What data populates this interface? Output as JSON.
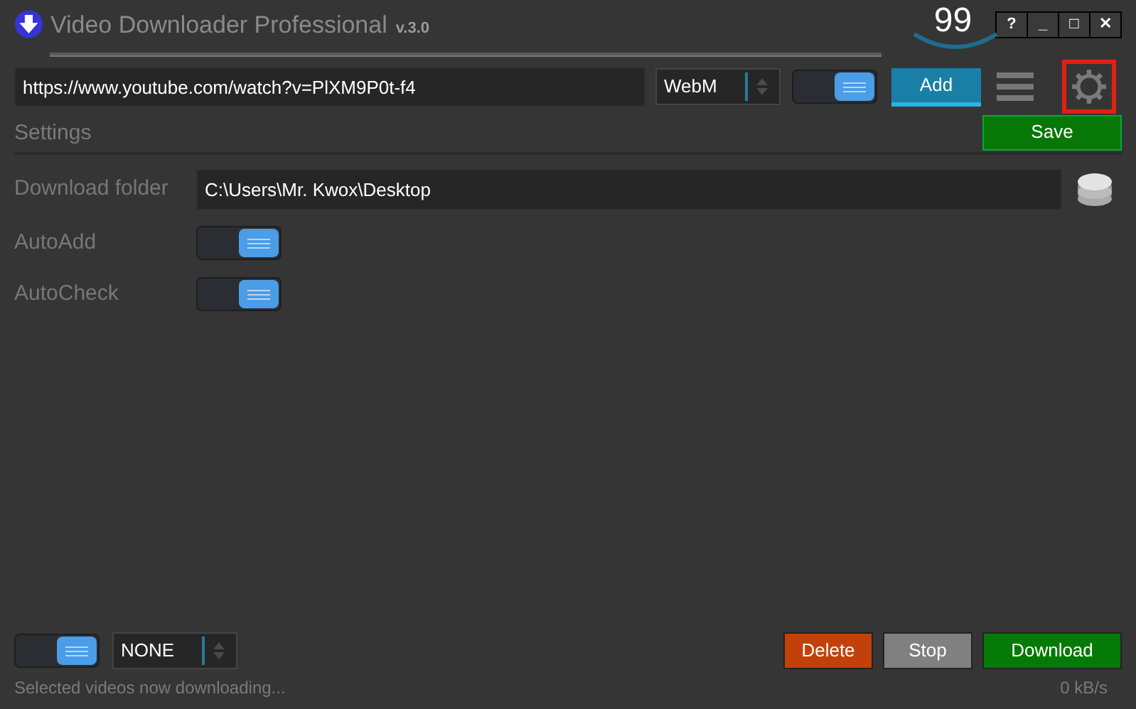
{
  "window": {
    "title": "Video Downloader Professional",
    "version": "v.3.0",
    "counter": "99",
    "controls": [
      "?",
      "_",
      "□",
      "✕"
    ]
  },
  "toolbar": {
    "url": "https://www.youtube.com/watch?v=PlXM9P0t-f4",
    "format": "WebM",
    "toggle_on": true,
    "add_label": "Add",
    "settings_highlighted": true
  },
  "settings": {
    "heading": "Settings",
    "save_label": "Save",
    "rows": [
      {
        "kind": "folder",
        "label": "Download folder",
        "value": "C:\\Users\\Mr. Kwox\\Desktop"
      },
      {
        "kind": "toggle",
        "label": "AutoAdd",
        "on": true
      },
      {
        "kind": "toggle",
        "label": "AutoCheck",
        "on": true
      }
    ]
  },
  "footer": {
    "toggle_on": true,
    "filter": "NONE",
    "buttons": [
      {
        "label": "Delete",
        "kind": "delete"
      },
      {
        "label": "Stop",
        "kind": "stop"
      },
      {
        "label": "Download",
        "kind": "download"
      }
    ],
    "status": "Selected videos now downloading...",
    "speed": "0 kB/s"
  }
}
